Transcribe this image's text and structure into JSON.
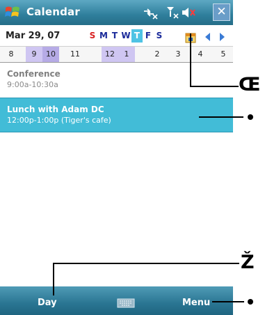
{
  "title_bar": {
    "app_title": "Calendar",
    "icons": [
      "windows-start-icon",
      "connectivity-icon",
      "signal-icon",
      "volume-icon"
    ],
    "close_label": "✕"
  },
  "date_header": {
    "current_date": "Mar 29, 07",
    "week_letters": [
      {
        "label": "S",
        "style": "sunday"
      },
      {
        "label": "M",
        "style": "normal"
      },
      {
        "label": "T",
        "style": "normal"
      },
      {
        "label": "W",
        "style": "normal"
      },
      {
        "label": "T",
        "style": "today"
      },
      {
        "label": "F",
        "style": "normal"
      },
      {
        "label": "S",
        "style": "normal"
      }
    ]
  },
  "day_strip": {
    "hours": [
      "8",
      "9",
      "10",
      "11",
      "12",
      "1",
      "2",
      "3",
      "4",
      "5"
    ],
    "busy_hours": [
      "9",
      "10"
    ],
    "busy_partial_hours": [
      "12",
      "1"
    ]
  },
  "appointments": [
    {
      "title": "Conference",
      "time": "9:00a-10:30a",
      "selected": false
    },
    {
      "title": "Lunch with Adam DC",
      "time": "12:00p-1:00p (Tiger's cafe)",
      "selected": true
    }
  ],
  "bottom_bar": {
    "left_softkey": "Day",
    "right_softkey": "Menu"
  },
  "callouts": {
    "today_marker": "Œ",
    "appointment_marker": "•",
    "left_softkey_marker": "Ž",
    "right_softkey_marker": "•"
  },
  "colors": {
    "title_bar": "#2f7f9c",
    "today_highlight": "#4ec3e4",
    "selected_appointment": "#42bcd7",
    "busy_hour": "#b6abe6",
    "sunday_letter": "#d82020",
    "weekday_letter": "#1a2a9a"
  }
}
